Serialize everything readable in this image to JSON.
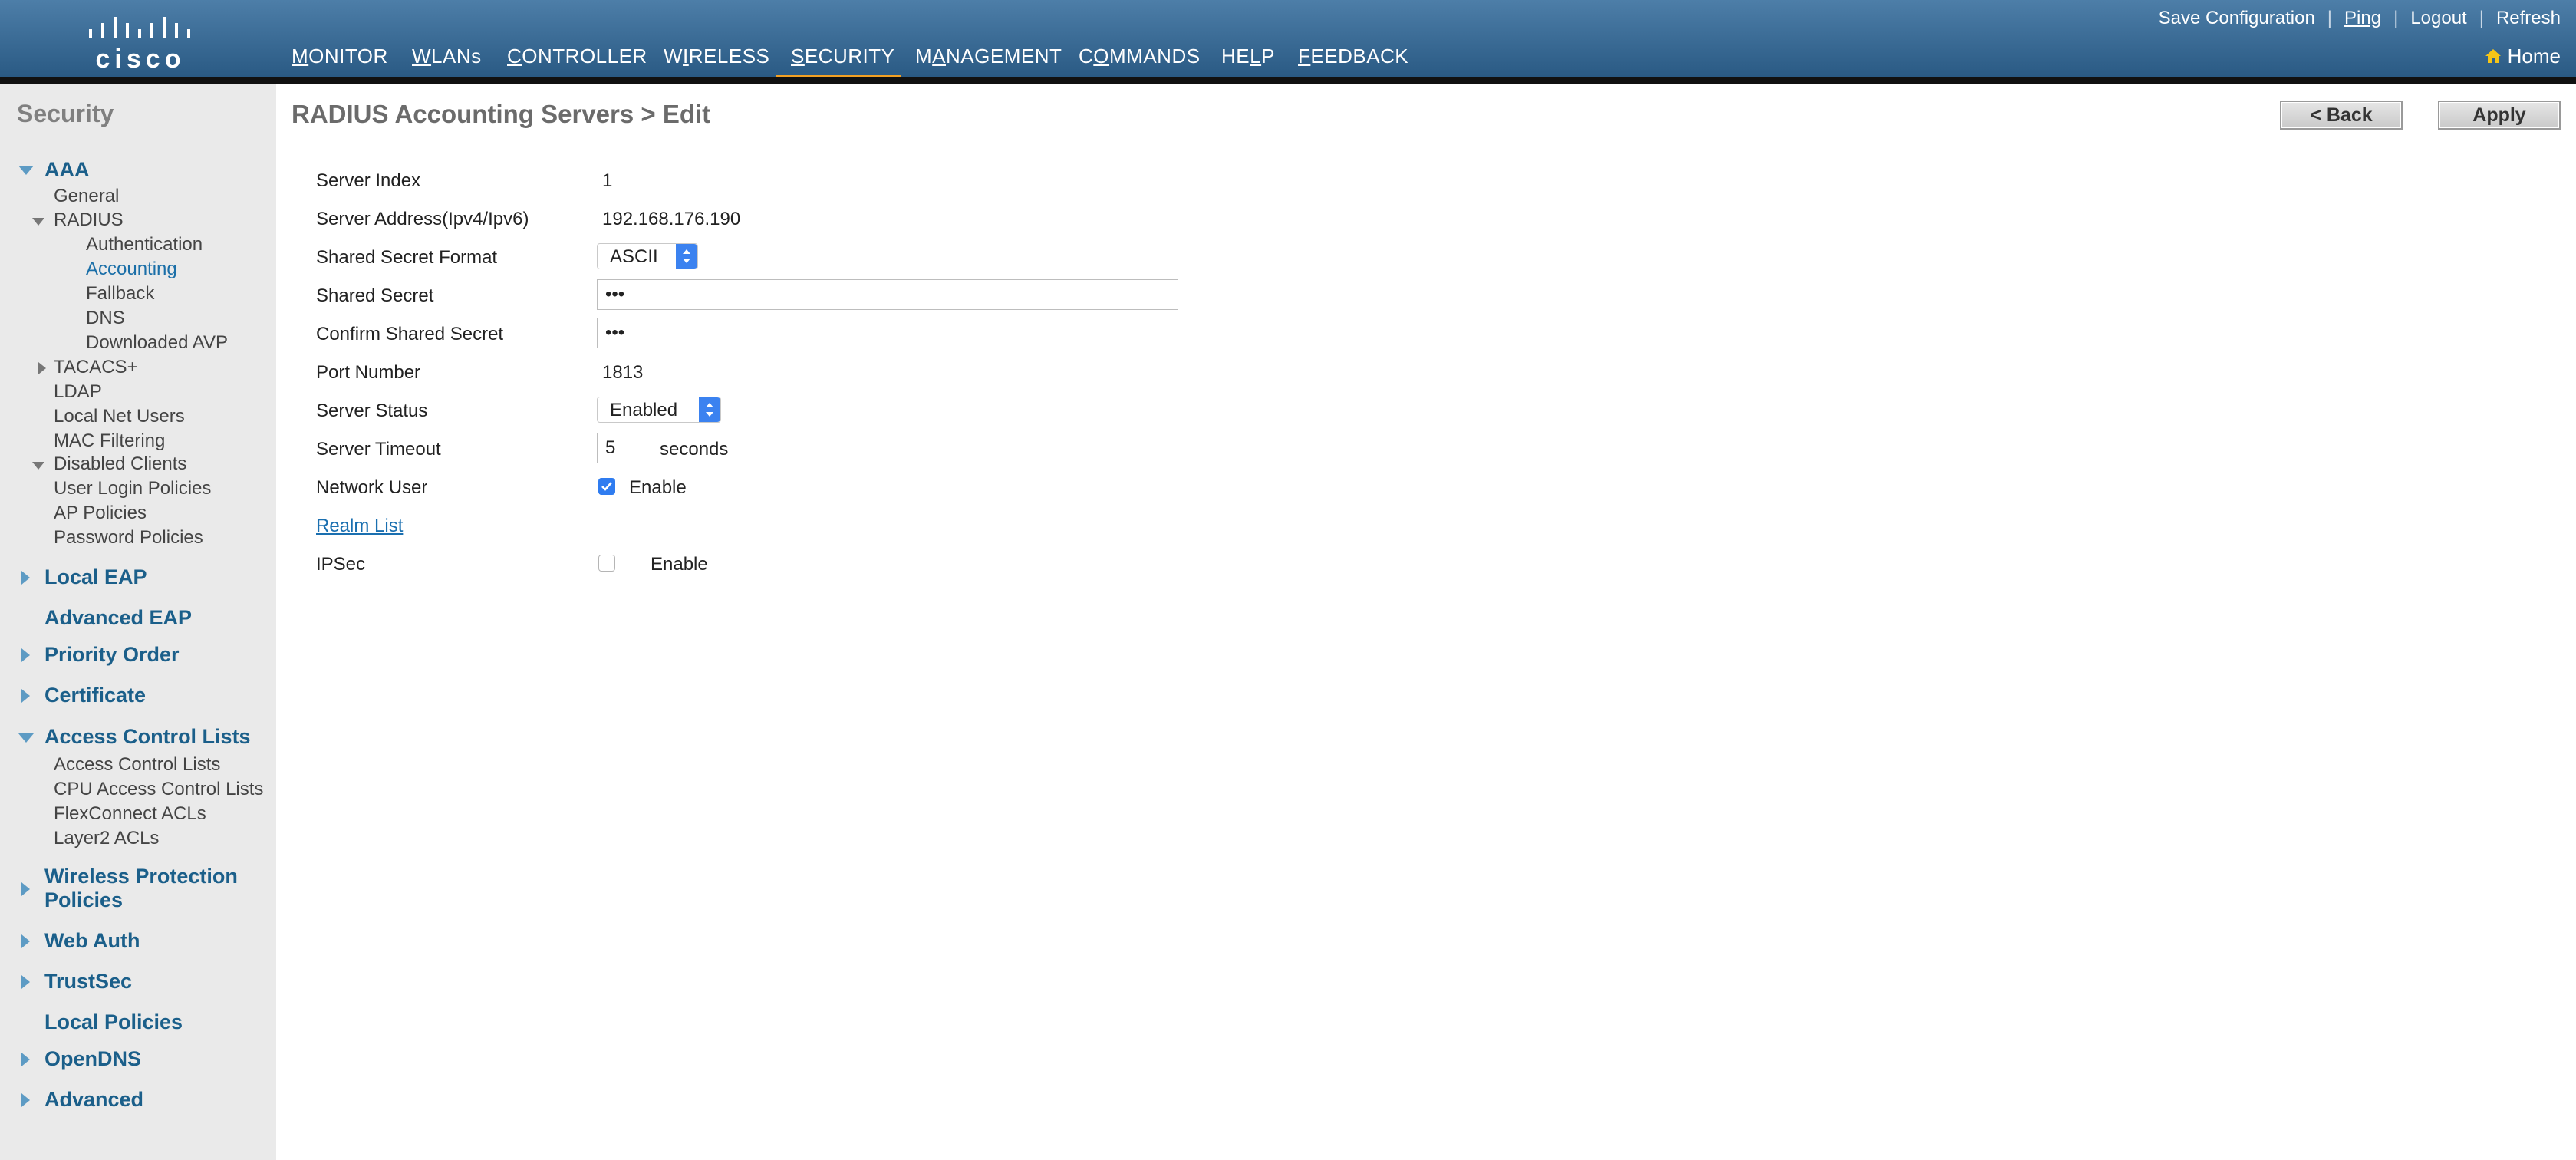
{
  "brand": {
    "logo_text": "cisco"
  },
  "top_links": {
    "save": "Save Configuration",
    "ping": "Ping",
    "logout": "Logout",
    "refresh": "Refresh",
    "separator": "|"
  },
  "home_label": "Home",
  "nav": [
    {
      "pre": "",
      "u": "M",
      "post": "ONITOR"
    },
    {
      "pre": "",
      "u": "W",
      "post": "LANs"
    },
    {
      "pre": "",
      "u": "C",
      "post": "ONTROLLER"
    },
    {
      "pre": "W",
      "u": "I",
      "post": "RELESS"
    },
    {
      "pre": "",
      "u": "S",
      "post": "ECURITY"
    },
    {
      "pre": "M",
      "u": "A",
      "post": "NAGEMENT"
    },
    {
      "pre": "C",
      "u": "O",
      "post": "MMANDS"
    },
    {
      "pre": "HE",
      "u": "L",
      "post": "P"
    },
    {
      "pre": "",
      "u": "F",
      "post": "EEDBACK"
    }
  ],
  "colors": {
    "header": "#2a5a84",
    "active_tab": "#f2a024",
    "section_link": "#1b5f8a",
    "checkbox_on": "#2f7cf0"
  },
  "sidebar": {
    "title": "Security",
    "aaa": "AAA",
    "general": "General",
    "radius": "RADIUS",
    "authentication": "Authentication",
    "accounting": "Accounting",
    "fallback": "Fallback",
    "dns": "DNS",
    "downloaded_avp": "Downloaded AVP",
    "tacacs": "TACACS+",
    "ldap": "LDAP",
    "local_net_users": "Local Net Users",
    "mac_filtering": "MAC Filtering",
    "disabled_clients": "Disabled Clients",
    "user_login_policies": "User Login Policies",
    "ap_policies": "AP Policies",
    "password_policies": "Password Policies",
    "local_eap": "Local EAP",
    "advanced_eap": "Advanced EAP",
    "priority_order": "Priority Order",
    "certificate": "Certificate",
    "acl": "Access Control Lists",
    "acl_sub": "Access Control Lists",
    "cpu_acl": "CPU Access Control Lists",
    "flexconnect_acls": "FlexConnect ACLs",
    "layer2_acls": "Layer2 ACLs",
    "wireless_protection_1": "Wireless Protection",
    "wireless_protection_2": "Policies",
    "web_auth": "Web Auth",
    "trustsec": "TrustSec",
    "local_policies": "Local Policies",
    "opendns": "OpenDNS",
    "advanced": "Advanced"
  },
  "main": {
    "title": "RADIUS Accounting Servers > Edit",
    "back_button": "< Back",
    "apply_button": "Apply",
    "fields": {
      "server_index_label": "Server Index",
      "server_index_value": "1",
      "server_address_label": "Server Address(Ipv4/Ipv6)",
      "server_address_value": "192.168.176.190",
      "secret_format_label": "Shared Secret Format",
      "secret_format_value": "ASCII",
      "shared_secret_label": "Shared Secret",
      "shared_secret_value": "•••",
      "confirm_secret_label": "Confirm Shared Secret",
      "confirm_secret_value": "•••",
      "port_label": "Port Number",
      "port_value": "1813",
      "status_label": "Server Status",
      "status_value": "Enabled",
      "timeout_label": "Server Timeout",
      "timeout_value": "5",
      "timeout_unit": "seconds",
      "network_user_label": "Network User",
      "network_user_enable": "Enable",
      "network_user_checked": true,
      "realm_list": "Realm List",
      "ipsec_label": "IPSec",
      "ipsec_enable": "Enable",
      "ipsec_checked": false
    }
  }
}
